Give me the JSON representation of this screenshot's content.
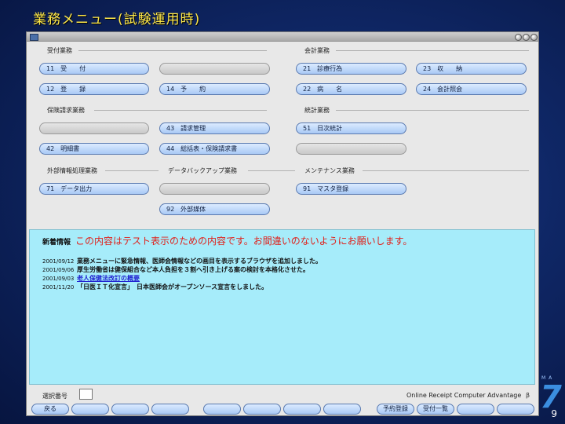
{
  "slide": {
    "title": "業務メニュー(試験運用時)",
    "page_number": "9",
    "logo_text": "7",
    "logo_caption": "M A"
  },
  "groups": {
    "reception": "受付業務",
    "accounting": "会計業務",
    "claims": "保険請求業務",
    "statistics": "統計業務",
    "external": "外部情報処理業務",
    "backup": "データバックアップ業務",
    "maintenance": "メンテナンス業務"
  },
  "buttons": {
    "b11": "11　受　　付",
    "b12": "12　登　　録",
    "b14": "14　予　　約",
    "b21": "21　診療行為",
    "b22": "22　病　　名",
    "b23": "23　収　　納",
    "b24": "24　会計照会",
    "b43": "43　請求管理",
    "b42": "42　明細書",
    "b44": "44　総括表・保険請求書",
    "b51": "51　日次統計",
    "b71": "71　データ出力",
    "b91": "91　マスタ登録",
    "b92": "92　外部媒体"
  },
  "news": {
    "header": "新着情報",
    "notice": "この内容はテスト表示のための内容です。お間違いのないようにお願いします。",
    "items": [
      {
        "date": "2001/09/12",
        "text": "業務メニューに緊急情報、医師会情報などの画目を表示するブラウザを追加しました。"
      },
      {
        "date": "2001/09/06",
        "text": "厚生労働省は健保組合など本人負担を３割へ引き上げる案の検討を本格化させた。"
      },
      {
        "date": "2001/09/03",
        "text": "老人保健法改訂の概要"
      },
      {
        "date": "2001/11/20",
        "text": "「日医ＩＴ化宣言」　日本医師会がオープンソース宣言をしました。"
      }
    ]
  },
  "footer": {
    "select_label": "選択番号",
    "select_value": "",
    "product_name": "Online Receipt Computer Advantage",
    "product_icon": "β",
    "back_label": "戻る",
    "reservation_label": "予約登録",
    "reception_list_label": "受付一覧"
  },
  "colors": {
    "background": "#0a1c4e",
    "title": "#ffe94a",
    "news_panel": "#a6ecfa",
    "notice": "#e0201a",
    "button": "#a9c9f5"
  }
}
